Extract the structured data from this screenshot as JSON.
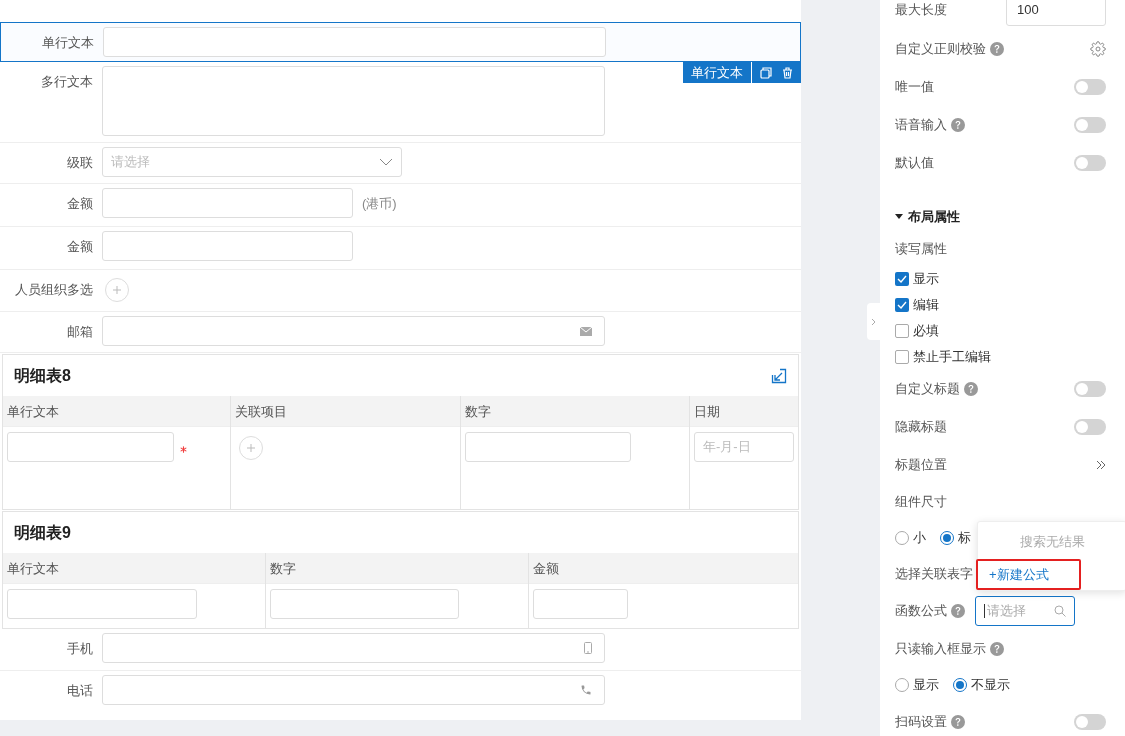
{
  "form": {
    "items": [
      {
        "kind": "text",
        "label": "单行文本",
        "selected": true,
        "toolbar_label": "单行文本"
      },
      {
        "kind": "textarea",
        "label": "多行文本",
        "selected": false
      },
      {
        "kind": "select",
        "label": "级联",
        "placeholder": "请选择",
        "selected": false
      },
      {
        "kind": "amount",
        "label": "金额",
        "suffix": "(港币)",
        "selected": false
      },
      {
        "kind": "amount",
        "label": "金额",
        "selected": false
      },
      {
        "kind": "people",
        "label": "人员组织多选",
        "selected": false
      },
      {
        "kind": "email",
        "label": "邮箱",
        "selected": false
      },
      {
        "kind": "table",
        "title": "明细表8",
        "columns": [
          {
            "header": "单行文本",
            "kind": "text",
            "required": true
          },
          {
            "header": "关联项目",
            "kind": "relation",
            "required": false
          },
          {
            "header": "数字",
            "kind": "number",
            "required": false
          },
          {
            "header": "日期",
            "kind": "date",
            "placeholder": "年-月-日",
            "required": false
          }
        ]
      },
      {
        "kind": "table",
        "title": "明细表9",
        "columns": [
          {
            "header": "单行文本",
            "kind": "text",
            "required": false
          },
          {
            "header": "数字",
            "kind": "number",
            "required": false
          },
          {
            "header": "金额",
            "kind": "amount",
            "required": false
          }
        ]
      },
      {
        "kind": "mobile",
        "label": "手机",
        "selected": false
      },
      {
        "kind": "phone",
        "label": "电话",
        "selected": false
      }
    ]
  },
  "panel": {
    "items": [
      {
        "kind": "input",
        "label": "最大长度",
        "value": "100"
      },
      {
        "kind": "settings",
        "label": "自定义正则校验",
        "help": true
      },
      {
        "kind": "switch",
        "label": "唯一值",
        "help": false,
        "on": false
      },
      {
        "kind": "switch",
        "label": "语音输入",
        "help": true,
        "on": false
      },
      {
        "kind": "switch",
        "label": "默认值",
        "help": false,
        "on": false
      },
      {
        "kind": "section",
        "label": "布局属性",
        "expanded": true
      },
      {
        "kind": "label",
        "label": "读写属性",
        "help": false
      },
      {
        "kind": "checkbox",
        "label": "显示",
        "checked": true
      },
      {
        "kind": "checkbox",
        "label": "编辑",
        "checked": true
      },
      {
        "kind": "checkbox",
        "label": "必填",
        "checked": false
      },
      {
        "kind": "checkbox",
        "label": "禁止手工编辑",
        "checked": false
      },
      {
        "kind": "switch",
        "label": "自定义标题",
        "help": true,
        "on": false
      },
      {
        "kind": "switch",
        "label": "隐藏标题",
        "help": false,
        "on": false
      },
      {
        "kind": "more",
        "label": "标题位置"
      },
      {
        "kind": "label",
        "label": "组件尺寸",
        "help": false
      },
      {
        "kind": "radios",
        "options": [
          {
            "label": "小",
            "selected": false
          },
          {
            "label": "标",
            "selected": true
          }
        ]
      },
      {
        "kind": "label",
        "label": "选择关联表字",
        "help": false
      },
      {
        "kind": "search",
        "label": "函数公式",
        "help": true,
        "placeholder": "请选择"
      },
      {
        "kind": "label",
        "label": "只读输入框显示",
        "help": true
      },
      {
        "kind": "radios",
        "options": [
          {
            "label": "显示",
            "selected": false
          },
          {
            "label": "不显示",
            "selected": true
          }
        ]
      },
      {
        "kind": "switch",
        "label": "扫码设置",
        "help": true,
        "on": false
      }
    ]
  },
  "dropdown": {
    "empty_text": "搜索无结果",
    "action": "+新建公式",
    "highlighted": true
  }
}
